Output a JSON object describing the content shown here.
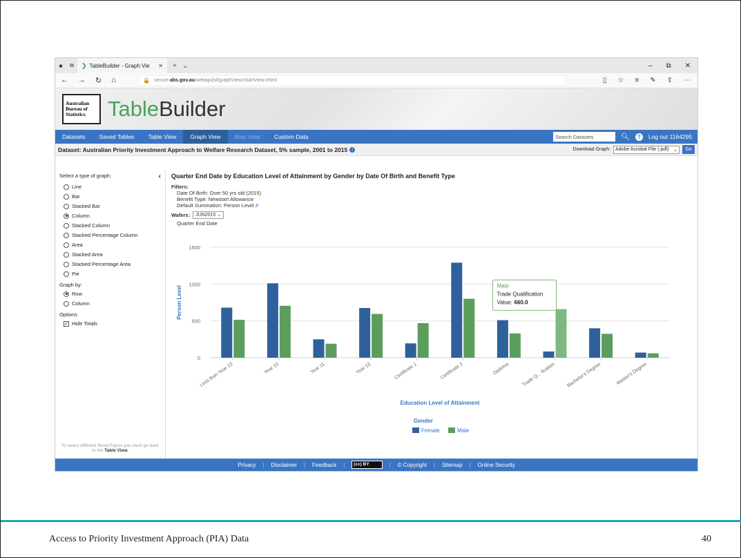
{
  "browser": {
    "tab_title": "TableBuilder - Graph Vie",
    "url_prefix": "secure.",
    "url_domain": "abs.gov.au",
    "url_path": "/webapi/jsf/graphView/chartView.xhtml"
  },
  "brand": {
    "logo_line1": "Australian",
    "logo_line2": "Bureau of",
    "logo_line3": "Statistics",
    "title_part1": "Table",
    "title_part2": "Builder"
  },
  "nav": {
    "items": [
      "Datasets",
      "Saved Tables",
      "Table View",
      "Graph View",
      "Map View",
      "Custom Data"
    ],
    "search_placeholder": "Search Datasets",
    "logout": "Log out 1164295"
  },
  "dataset_bar": {
    "label": "Dataset: Australian Priority Investment Approach to Welfare Research Dataset, 5% sample, 2001 to 2015",
    "download_label": "Download Graph:",
    "download_value": "Adobe Acrobat File (.pdf)",
    "go": "Go"
  },
  "sidebar": {
    "graph_type_heading": "Select a type of graph:",
    "graph_types": [
      "Line",
      "Bar",
      "Stacked Bar",
      "Column",
      "Stacked Column",
      "Stacked Percentage Column",
      "Area",
      "Stacked Area",
      "Stacked Percentage Area",
      "Pie"
    ],
    "graph_types_selected": "Column",
    "graph_by_heading": "Graph by:",
    "graph_by": [
      "Row",
      "Column"
    ],
    "graph_by_selected": "Row",
    "options_heading": "Options",
    "hide_totals": "Hide Totals",
    "note_text": "To select different Items\\Topics you must go back to the",
    "note_link": "Table View."
  },
  "main": {
    "title": "Quarter End Date by Education Level of Attainment by Gender by Date Of Birth and Benefit Type",
    "filters_label": "Filters:",
    "filters": [
      "Date Of Birth: Over 50 yrs old (2015)",
      "Benefit Type: Newstart Allowance",
      "Default Summation: Person Level"
    ],
    "hash": "#",
    "wafers_label": "Wafers:",
    "wafers_value": "JUN2015",
    "quarter_label": "Quarter End Date"
  },
  "chart_data": {
    "type": "bar",
    "categories": [
      "Less than Year 10",
      "Year 10",
      "Year 11",
      "Year 12",
      "Certificate 1",
      "Certificate 2",
      "Diploma",
      "Trade Qualification",
      "Bachelor's Degree",
      "Master's Degree"
    ],
    "tick_labels": [
      "Less than Year 10",
      "Year 10",
      "Year 11",
      "Year 12",
      "Certificate 1",
      "Certificate 2",
      "Diploma",
      "Trade Q... fication",
      "Bachelor's Degree",
      "Master's Degree"
    ],
    "series": [
      {
        "name": "Female",
        "color": "#2e619c",
        "values": [
          680,
          1010,
          250,
          675,
          195,
          1290,
          510,
          85,
          400,
          70
        ]
      },
      {
        "name": "Male",
        "color": "#5b9e5b",
        "values": [
          515,
          705,
          190,
          595,
          470,
          800,
          330,
          660,
          325,
          60
        ]
      }
    ],
    "xlabel": "Education Level of Attainment",
    "ylabel": "Person Level",
    "ylim": [
      0,
      1500
    ],
    "yticks": [
      0,
      500,
      1000,
      1500
    ],
    "legend_title": "Gender",
    "legend_position": "bottom",
    "grid": true,
    "tooltip": {
      "series": "Male",
      "category": "Trade Qualification",
      "value_label": "Value:",
      "value": "660.0"
    }
  },
  "footer": {
    "links": [
      "Privacy",
      "Disclaimer",
      "Feedback",
      "© Copyright",
      "Sitemap",
      "Online Security"
    ],
    "cc": "(cc) BY"
  },
  "slide": {
    "footer_text": "Access to Priority Investment Approach (PIA) Data",
    "page_number": "40"
  }
}
